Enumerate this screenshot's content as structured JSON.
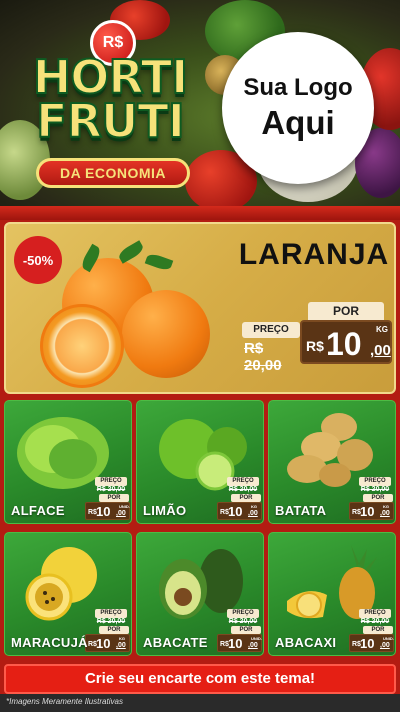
{
  "header": {
    "currency_badge": "R$",
    "brand_line1": "HORTI",
    "brand_line2": "FRUTI",
    "brand_ribbon": "DA ECONOMIA",
    "logo_line1": "Sua Logo",
    "logo_line2": "Aqui"
  },
  "featured": {
    "discount": "-50%",
    "name": "LARANJA",
    "por_label": "POR",
    "preco_label": "PREÇO",
    "old_price": "R$ 20,00",
    "currency": "R$",
    "price_int": "10",
    "price_dec": ",00",
    "unit": "KG"
  },
  "products": [
    {
      "name": "ALFACE",
      "preco_label": "PREÇO",
      "old_price": "R$ 20,00",
      "por_label": "POR",
      "currency": "R$",
      "price_int": "10",
      "price_dec": ",00",
      "unit": "UNID."
    },
    {
      "name": "LIMÃO",
      "preco_label": "PREÇO",
      "old_price": "R$ 20,00",
      "por_label": "POR",
      "currency": "R$",
      "price_int": "10",
      "price_dec": ",00",
      "unit": "KG"
    },
    {
      "name": "BATATA",
      "preco_label": "PREÇO",
      "old_price": "R$ 20,00",
      "por_label": "POR",
      "currency": "R$",
      "price_int": "10",
      "price_dec": ",00",
      "unit": "KG"
    },
    {
      "name": "MARACUJÁ",
      "preco_label": "PREÇO",
      "old_price": "R$ 20,00",
      "por_label": "POR",
      "currency": "R$",
      "price_int": "10",
      "price_dec": ",00",
      "unit": "KG"
    },
    {
      "name": "ABACATE",
      "preco_label": "PREÇO",
      "old_price": "R$ 20,00",
      "por_label": "POR",
      "currency": "R$",
      "price_int": "10",
      "price_dec": ",00",
      "unit": "UNID."
    },
    {
      "name": "ABACAXI",
      "preco_label": "PREÇO",
      "old_price": "R$ 20,00",
      "por_label": "POR",
      "currency": "R$",
      "price_int": "10",
      "price_dec": ",00",
      "unit": "UNID."
    }
  ],
  "cta": "Crie seu encarte com este tema!",
  "footer_note": "*Imagens Meramente Ilustrativas",
  "colors": {
    "accent_red": "#e51f14",
    "card_green": "#2a8a2a",
    "feature_gold": "#d6ad47",
    "price_brown": "#5a3415",
    "brand_yellow": "#f6e27a"
  }
}
